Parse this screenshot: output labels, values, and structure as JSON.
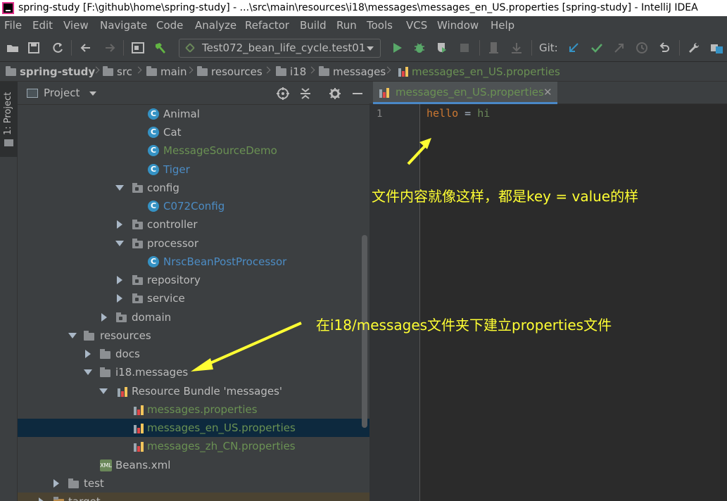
{
  "window": {
    "title": "spring-study [F:\\github\\home\\spring-study] - ...\\src\\main\\resources\\i18\\messages\\messages_en_US.properties [spring-study] - IntelliJ IDEA"
  },
  "menu": [
    "File",
    "Edit",
    "View",
    "Navigate",
    "Code",
    "Analyze",
    "Refactor",
    "Build",
    "Run",
    "Tools",
    "VCS",
    "Window",
    "Help"
  ],
  "toolbar": {
    "run_config": "Test072_bean_life_cycle.test01",
    "git_label": "Git:"
  },
  "breadcrumbs": [
    "spring-study",
    "src",
    "main",
    "resources",
    "i18",
    "messages",
    "messages_en_US.properties"
  ],
  "side_strip": {
    "label": "1: Project"
  },
  "project_panel": {
    "title": "Project",
    "tree": [
      {
        "label": "Animal",
        "type": "class"
      },
      {
        "label": "Cat",
        "type": "class"
      },
      {
        "label": "MessageSourceDemo",
        "type": "class"
      },
      {
        "label": "Tiger",
        "type": "class"
      },
      {
        "label": "config",
        "type": "folder"
      },
      {
        "label": "C072Config",
        "type": "class"
      },
      {
        "label": "controller",
        "type": "folder"
      },
      {
        "label": "processor",
        "type": "folder"
      },
      {
        "label": "NrscBeanPostProcessor",
        "type": "class"
      },
      {
        "label": "repository",
        "type": "folder"
      },
      {
        "label": "service",
        "type": "folder"
      },
      {
        "label": "domain",
        "type": "folder"
      },
      {
        "label": "resources",
        "type": "folder"
      },
      {
        "label": "docs",
        "type": "folder"
      },
      {
        "label": "i18.messages",
        "type": "folder"
      },
      {
        "label": "Resource Bundle 'messages'",
        "type": "bundle"
      },
      {
        "label": "messages.properties",
        "type": "properties"
      },
      {
        "label": "messages_en_US.properties",
        "type": "properties",
        "selected": true
      },
      {
        "label": "messages_zh_CN.properties",
        "type": "properties"
      },
      {
        "label": "Beans.xml",
        "type": "xml"
      },
      {
        "label": "test",
        "type": "folder"
      },
      {
        "label": "target",
        "type": "folder"
      }
    ]
  },
  "editor": {
    "tab_label": "messages_en_US.properties",
    "tab_close": "✕",
    "line_number": "1",
    "code_key": "hello",
    "code_eq": " = ",
    "code_value": "hi"
  },
  "annotations": {
    "top": "文件内容就像这样，都是key = value的样",
    "middle": "在i18/messages文件夹下建立properties文件"
  },
  "colors": {
    "accent": "#4a88c7",
    "annotation": "#ffff33",
    "selection": "#0d293e"
  }
}
